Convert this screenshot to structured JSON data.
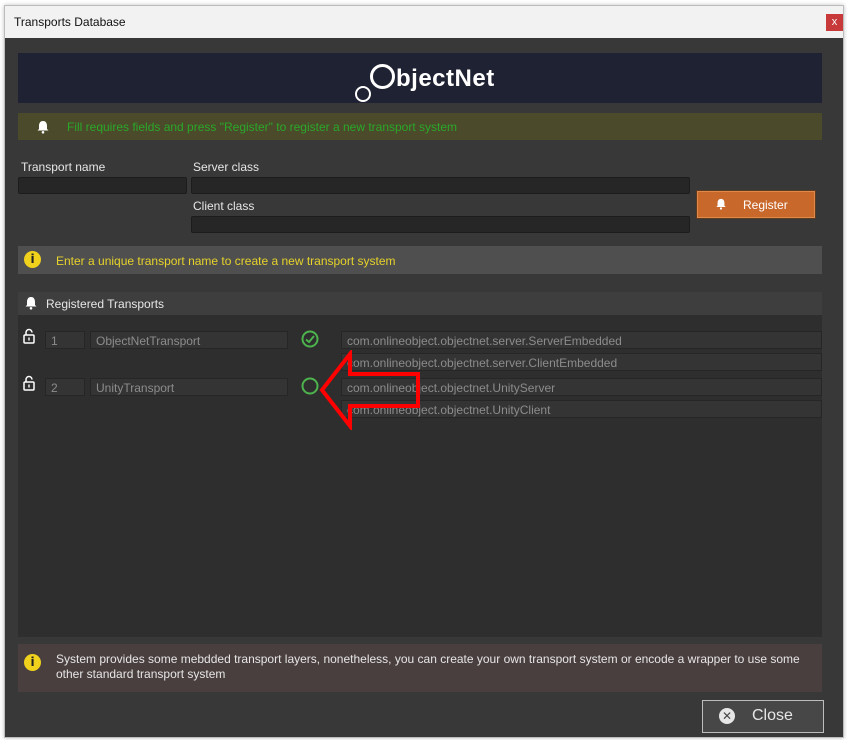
{
  "window": {
    "title": "Transports Database",
    "close_glyph": "x"
  },
  "banner": {
    "logo_text": "bjectNet"
  },
  "hints": {
    "register": "Fill requires fields and press \"Register\" to register a new transport system",
    "name": "Enter a unique transport name to create a new transport system",
    "bottom": "System provides some mebdded transport layers, nonetheless, you can create your own transport system or encode a wrapper to use some other standard transport system"
  },
  "form": {
    "transport_name_label": "Transport name",
    "server_class_label": "Server class",
    "client_class_label": "Client class",
    "register_label": "Register"
  },
  "registered": {
    "title": "Registered Transports",
    "rows": [
      {
        "index": "1",
        "name": "ObjectNetTransport",
        "server": "com.onlineobject.objectnet.server.ServerEmbedded",
        "client": "com.onlineobject.objectnet.server.ClientEmbedded",
        "status": "check-circle-icon"
      },
      {
        "index": "2",
        "name": "UnityTransport",
        "server": "com.onlineobject.objectnet.UnityServer",
        "client": "com.onlineobject.objectnet.UnityClient",
        "status": "empty-circle-icon"
      }
    ]
  },
  "footer": {
    "close_label": "Close"
  },
  "colors": {
    "accent": "#c8682b",
    "success": "#4db34d",
    "annotation_arrow": "#ff0000"
  }
}
